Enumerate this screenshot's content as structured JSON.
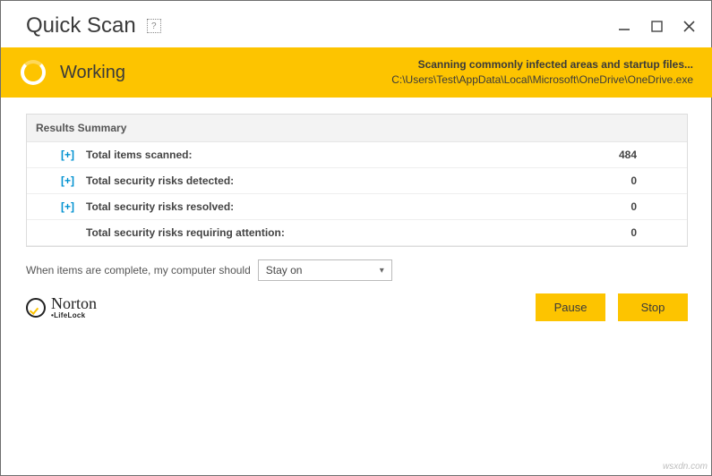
{
  "titlebar": {
    "title": "Quick Scan",
    "help": "?"
  },
  "status": {
    "state": "Working",
    "headline": "Scanning commonly infected areas and startup files...",
    "current_file": "C:\\Users\\Test\\AppData\\Local\\Microsoft\\OneDrive\\OneDrive.exe"
  },
  "results": {
    "header": "Results Summary",
    "rows": [
      {
        "expandable": true,
        "label": "Total items scanned:",
        "value": "484"
      },
      {
        "expandable": true,
        "label": "Total security risks detected:",
        "value": "0"
      },
      {
        "expandable": true,
        "label": "Total security risks resolved:",
        "value": "0"
      },
      {
        "expandable": false,
        "label": "Total security risks requiring attention:",
        "value": "0"
      }
    ]
  },
  "after_scan": {
    "label": "When items are complete, my computer should",
    "selected": "Stay on"
  },
  "brand": {
    "name": "Norton",
    "sub": "•LifeLock"
  },
  "buttons": {
    "pause": "Pause",
    "stop": "Stop"
  },
  "watermark": "wsxdn.com",
  "expand_glyph": "[+]"
}
